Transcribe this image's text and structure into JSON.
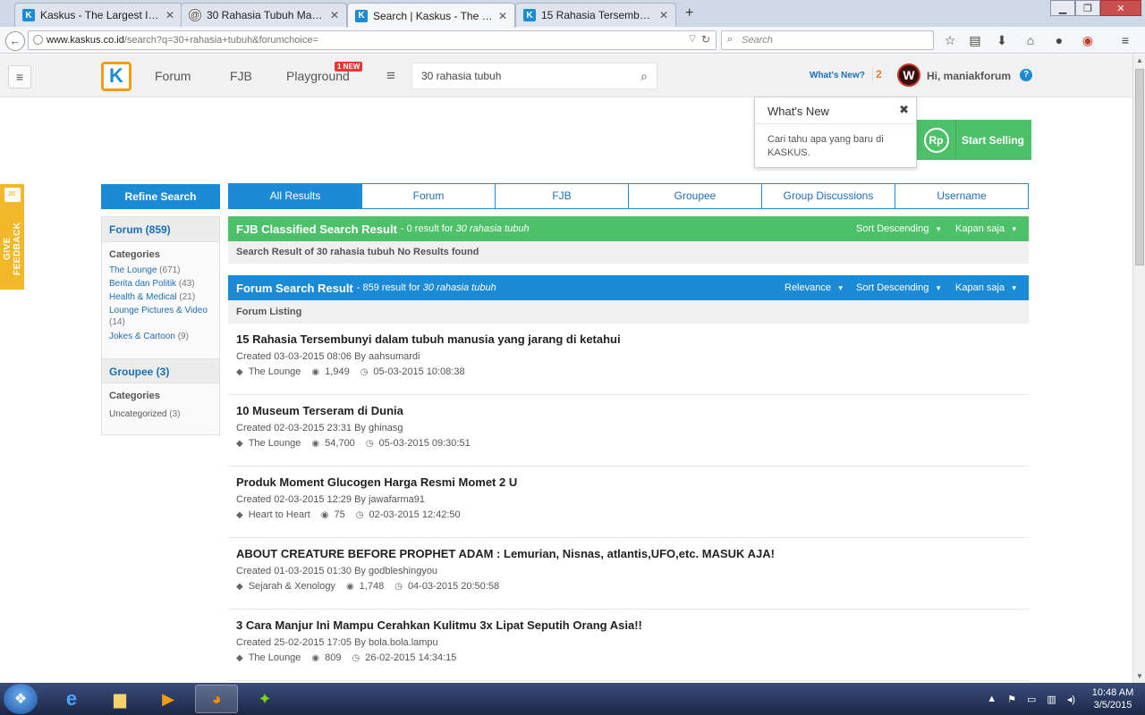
{
  "browser": {
    "tabs": [
      {
        "title": "Kaskus - The Largest Indon...",
        "favicon": "K"
      },
      {
        "title": "30 Rahasia Tubuh Manusia...",
        "favicon": "@"
      },
      {
        "title": "Search | Kaskus - The Large...",
        "favicon": "K"
      },
      {
        "title": "15 Rahasia Tersembunyi da...",
        "favicon": "K"
      }
    ],
    "new_tab": "+",
    "url_host": "www.kaskus.co.id",
    "url_path": "/search?q=30+rahasia+tubuh&forumchoice=",
    "search_placeholder": "Search",
    "window_buttons": {
      "minimize": "▁",
      "maximize": "❐",
      "close": "✕"
    }
  },
  "header": {
    "menu_icon": "≡",
    "logo": "K",
    "nav": {
      "forum": "Forum",
      "fjb": "FJB",
      "playground": "Playground"
    },
    "new_badge": "1 NEW",
    "search_value": "30 rahasia tubuh",
    "whats_new": "What's New?",
    "whats_new_count": "2",
    "avatar_letter": "W",
    "greeting": "Hi, maniakforum",
    "help": "?"
  },
  "popover": {
    "title": "What's New",
    "close": "✖",
    "body": "Cari tahu apa yang baru di KASKUS."
  },
  "sell": {
    "icon": "Rp",
    "label": "Start Selling"
  },
  "feedback": {
    "label": "GIVE FEEDBACK"
  },
  "sidebar": {
    "refine": "Refine Search",
    "forum_header": "Forum (859)",
    "forum_categories_label": "Categories",
    "forum_categories": [
      {
        "name": "The Lounge",
        "count": "(671)"
      },
      {
        "name": "Berita dan Politik",
        "count": "(43)"
      },
      {
        "name": "Health & Medical",
        "count": "(21)"
      },
      {
        "name": "Lounge Pictures & Video",
        "count": "(14)"
      },
      {
        "name": "Jokes & Cartoon",
        "count": "(9)"
      }
    ],
    "groupee_header": "Groupee (3)",
    "groupee_categories_label": "Categories",
    "groupee_categories": [
      {
        "name": "Uncategorized",
        "count": "(3)"
      }
    ]
  },
  "tabs": [
    "All Results",
    "Forum",
    "FJB",
    "Groupee",
    "Group Discussions",
    "Username"
  ],
  "fjb": {
    "title": "FJB Classified Search Result",
    "summary_prefix": "- 0 result for",
    "query": "30 rahasia tubuh",
    "sort": "Sort Descending",
    "time": "Kapan saja",
    "no_results": "Search Result of 30 rahasia tubuh No Results found"
  },
  "forum": {
    "title": "Forum Search Result",
    "summary_prefix": "- 859 result for",
    "query": "30 rahasia tubuh",
    "relevance": "Relevance",
    "sort": "Sort Descending",
    "time": "Kapan saja",
    "listing_label": "Forum Listing"
  },
  "results": [
    {
      "title": "15 Rahasia Tersembunyi dalam tubuh manusia yang jarang di ketahui",
      "created": "Created 03-03-2015 08:06 By aahsumardi",
      "category": "The Lounge",
      "views": "1,949",
      "last": "05-03-2015 10:08:38"
    },
    {
      "title": "10 Museum Terseram di Dunia",
      "created": "Created 02-03-2015 23:31 By ghinasg",
      "category": "The Lounge",
      "views": "54,700",
      "last": "05-03-2015 09:30:51"
    },
    {
      "title": "Produk Moment Glucogen Harga Resmi Momet 2 U",
      "created": "Created 02-03-2015 12:29 By jawafarma91",
      "category": "Heart to Heart",
      "views": "75",
      "last": "02-03-2015 12:42:50"
    },
    {
      "title": "ABOUT CREATURE BEFORE PROPHET ADAM : Lemurian, Nisnas, atlantis,UFO,etc. MASUK AJA!",
      "created": "Created 01-03-2015 01:30 By godbleshingyou",
      "category": "Sejarah & Xenology",
      "views": "1,748",
      "last": "04-03-2015 20:50:58"
    },
    {
      "title": "3 Cara Manjur Ini Mampu Cerahkan Kulitmu 3x Lipat Seputih Orang Asia!!",
      "created": "Created 25-02-2015 17:05 By bola.bola.lampu",
      "category": "The Lounge",
      "views": "809",
      "last": "26-02-2015 14:34:15"
    }
  ],
  "taskbar": {
    "time": "10:48 AM",
    "date": "3/5/2015"
  }
}
